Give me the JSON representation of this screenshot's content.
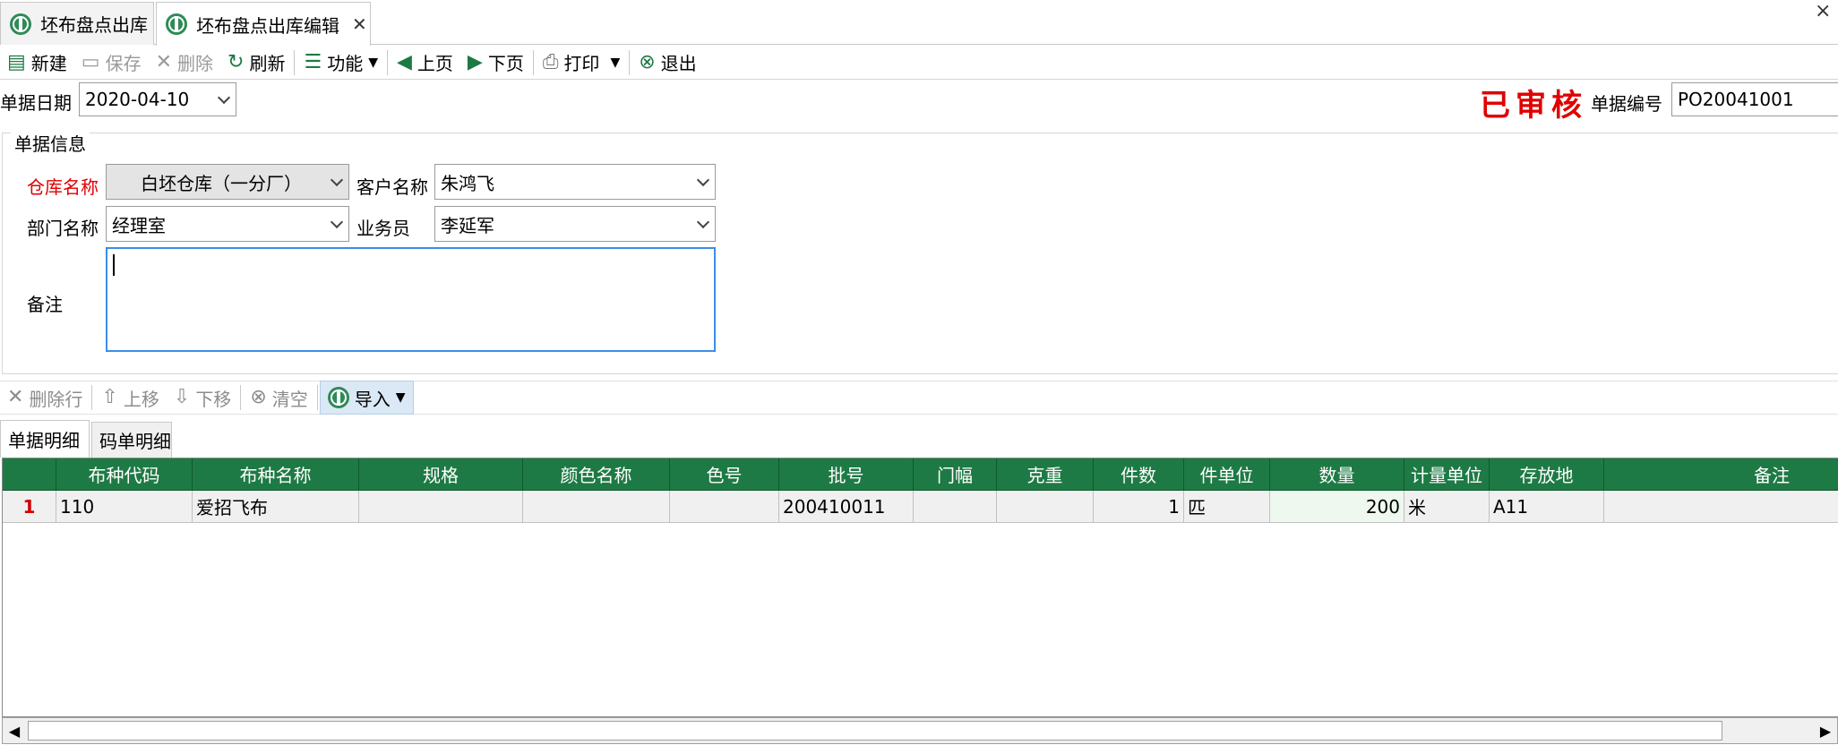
{
  "tabs": [
    {
      "label": "坯布盘点出库",
      "icon": "globe-icon"
    },
    {
      "label": "坯布盘点出库编辑",
      "icon": "globe-icon",
      "close": "✕"
    }
  ],
  "window_close": "×",
  "toolbar": {
    "new": "新建",
    "save": "保存",
    "delete": "删除",
    "refresh": "刷新",
    "function": "功能",
    "prev": "上页",
    "next": "下页",
    "print": "打印",
    "exit": "退出"
  },
  "header": {
    "date_label": "单据日期",
    "date_value": "2020-04-10",
    "status": "已审核",
    "docno_label": "单据编号",
    "docno_value": "PO20041001"
  },
  "group": {
    "title": "单据信息",
    "warehouse_label": "仓库名称",
    "warehouse_value": "白坯仓库（一分厂）",
    "customer_label": "客户名称",
    "customer_value": "朱鸿飞",
    "department_label": "部门名称",
    "department_value": "经理室",
    "salesman_label": "业务员",
    "salesman_value": "李延军",
    "remark_label": "备注",
    "remark_value": ""
  },
  "grid_toolbar": {
    "delete_row": "删除行",
    "move_up": "上移",
    "move_down": "下移",
    "clear": "清空",
    "import": "导入"
  },
  "sub_tabs": [
    "单据明细",
    "码单明细"
  ],
  "grid": {
    "columns": [
      "",
      "布种代码",
      "布种名称",
      "规格",
      "颜色名称",
      "色号",
      "批号",
      "门幅",
      "克重",
      "件数",
      "件单位",
      "数量",
      "计量单位",
      "存放地",
      "备注"
    ],
    "rows": [
      [
        "1",
        "110",
        "爱招飞布",
        "",
        "",
        "",
        "200410011",
        "",
        "",
        "1",
        "匹",
        "200",
        "米",
        "A11",
        ""
      ]
    ]
  },
  "colors": {
    "grid_header": "#1e7a44",
    "status_red": "#e00000",
    "required_label": "#e00000",
    "active_input_border": "#3a8ee6"
  }
}
